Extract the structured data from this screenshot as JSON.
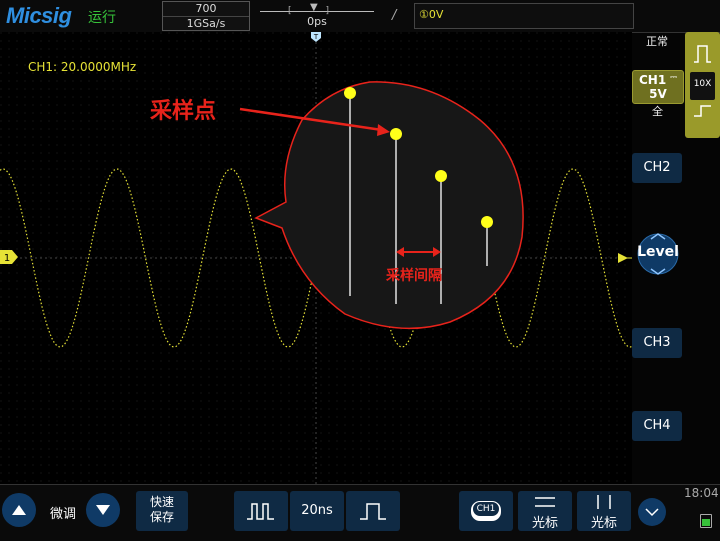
{
  "topbar": {
    "logo": "Micsig",
    "run_state": "运行",
    "acquisition": {
      "memory": "700",
      "sample_rate": "1GSa/s"
    },
    "time_position": "0ps",
    "trigger": "①0V",
    "mode": "正常"
  },
  "screen": {
    "channel_info": "CH1: 20.0000MHz",
    "channel_marker": "1",
    "annotation_sample_point": "采样点",
    "annotation_sample_interval": "采样间隔",
    "trace_color": "#e6e236",
    "annotation_color": "#e8231b"
  },
  "right_panel": {
    "ch1": {
      "name": "CH1",
      "scale": "5V",
      "coupling_icon": "dc-coupling-icon",
      "bandwidth": "全"
    },
    "probe": "10X",
    "ch2": "CH2",
    "level": "Level",
    "ch3": "CH3",
    "ch4": "CH4"
  },
  "bottombar": {
    "fine_tune": "微调",
    "quick_save": "快速保存",
    "timebase": "20ns",
    "ch_selector": "CH1",
    "cursor1": "光标",
    "cursor2": "光标",
    "clock": "18:04"
  }
}
